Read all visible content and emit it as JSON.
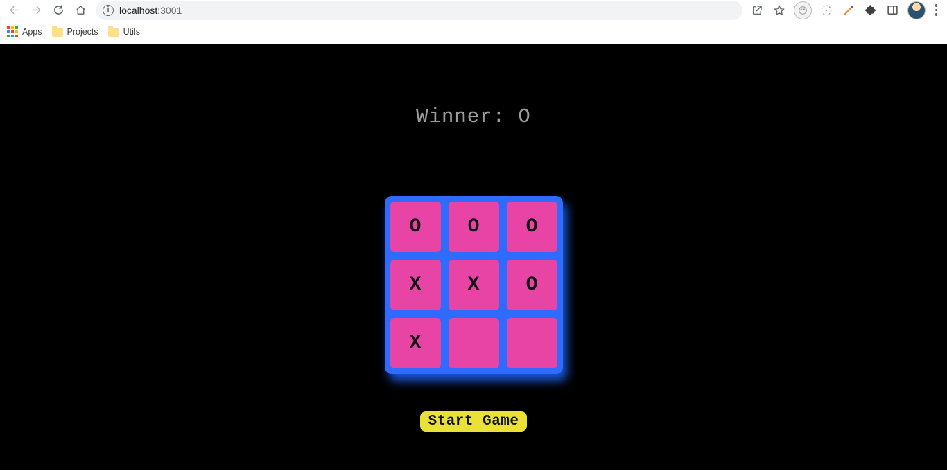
{
  "browser": {
    "url_host": "localhost:",
    "url_port": "3001",
    "bookmarks": {
      "apps": "Apps",
      "projects": "Projects",
      "utils": "Utils"
    }
  },
  "game": {
    "status": "Winner: O",
    "board": [
      "O",
      "O",
      "O",
      "X",
      "X",
      "O",
      "X",
      "",
      ""
    ],
    "start_label": "Start Game"
  }
}
